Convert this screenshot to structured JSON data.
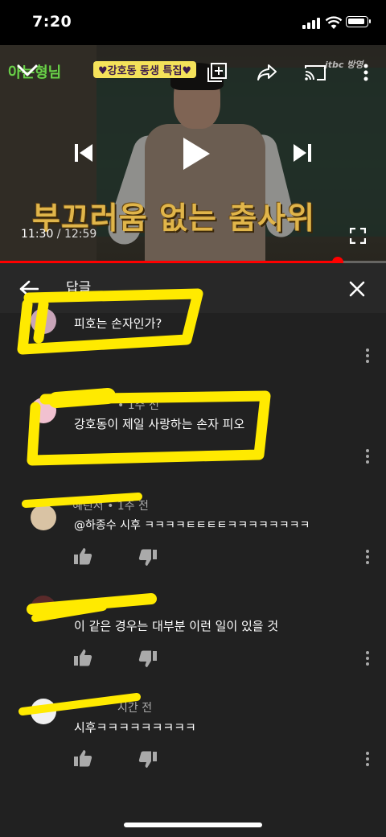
{
  "status_bar": {
    "time": "7:20"
  },
  "video": {
    "show_logo": "아는형님",
    "special_tag": "♥강호동 동생 특집♥",
    "channel_logo": "jtbc 방영",
    "caption": "부끄러움 없는 춤사위",
    "current_time": "11:30",
    "separator": " / ",
    "duration": "12:59",
    "progress": 0.874
  },
  "controls": {
    "collapse_icon": "chevron-down-icon",
    "add_to_playlist_icon": "playlist-add-icon",
    "share_icon": "share-icon",
    "cast_icon": "cast-icon",
    "more_icon": "more-vert-icon",
    "previous_icon": "skip-previous-icon",
    "play_icon": "play-icon",
    "next_icon": "skip-next-icon",
    "fullscreen_icon": "fullscreen-icon"
  },
  "panel": {
    "title": "답글"
  },
  "comments": [
    {
      "meta": "",
      "text": "피호는 손자인가?"
    },
    {
      "meta": "• 1주 전",
      "text": "강호동이 제일 사랑하는 손자 피오"
    },
    {
      "meta": "혜린서 • 1주 전",
      "text": "@하종수 시후 ㅋㅋㅋㅋㅌㅌㅌㅌㅋㅋㅋㅋㅋㅋㅋㅋ"
    },
    {
      "meta": "",
      "text": "이 같은 경우는 대부분 이런 일이 있을 것"
    },
    {
      "meta": "시간 전",
      "text": "시후ㅋㅋㅋㅋㅋㅋㅋㅋㅋ"
    }
  ],
  "highlight_color": "#ffea00",
  "accent_color": "#ff0000"
}
